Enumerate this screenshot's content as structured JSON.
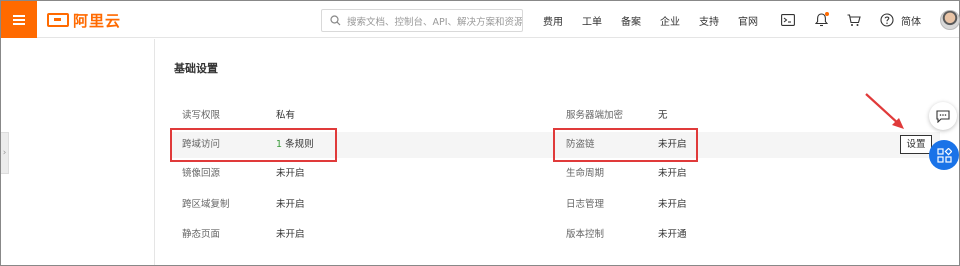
{
  "topbar": {
    "logo_text": "阿里云",
    "search_placeholder": "搜索文档、控制台、API、解决方案和资源",
    "nav_items": [
      "费用",
      "工单",
      "备案",
      "企业",
      "支持",
      "官网"
    ],
    "icons": [
      "terminal-icon",
      "bell-icon",
      "cart-icon",
      "help-icon"
    ],
    "language": "简体",
    "accent_color": "#ff6a00"
  },
  "main": {
    "section_title": "基础设置",
    "left_rows": [
      {
        "label": "读写权限",
        "value": "私有"
      },
      {
        "label": "跨域访问",
        "value_num": "1",
        "value": "条规则"
      },
      {
        "label": "镜像回源",
        "value": "未开启"
      },
      {
        "label": "跨区域复制",
        "value": "未开启"
      },
      {
        "label": "静态页面",
        "value": "未开启"
      }
    ],
    "right_rows": [
      {
        "label": "服务器端加密",
        "value": "无"
      },
      {
        "label": "防盗链",
        "value": "未开启"
      },
      {
        "label": "生命周期",
        "value": "未开启"
      },
      {
        "label": "日志管理",
        "value": "未开启"
      },
      {
        "label": "版本控制",
        "value": "未开通"
      }
    ],
    "settings_button": "设置"
  },
  "annotations": {
    "box_color": "#e03a3a",
    "arrow_color": "#e03a3a"
  }
}
